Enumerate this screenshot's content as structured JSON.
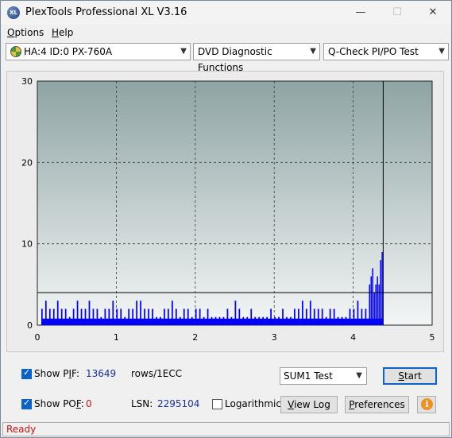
{
  "window": {
    "title": "PlexTools Professional XL V3.16",
    "icon_text": "XL"
  },
  "menu": [
    {
      "label": "Options",
      "accel": "O"
    },
    {
      "label": "Help",
      "accel": "H"
    }
  ],
  "toolbar": {
    "drive": "HA:4 ID:0  PX-760A",
    "function": "DVD Diagnostic Functions",
    "test": "Q-Check PI/PO Test"
  },
  "chart_data": {
    "type": "bar",
    "xlim": [
      0,
      5
    ],
    "ylim": [
      0,
      30
    ],
    "x_ticks": [
      "0",
      "1",
      "2",
      "3",
      "4",
      "5"
    ],
    "y_ticks": [
      "0",
      "10",
      "20",
      "30"
    ],
    "grid": true,
    "threshold": 4,
    "end_marker_x": 4.38,
    "series": [
      {
        "color": "#0000ff",
        "x": [
          0.05,
          0.1,
          0.15,
          0.2,
          0.25,
          0.3,
          0.35,
          0.4,
          0.45,
          0.5,
          0.55,
          0.6,
          0.65,
          0.7,
          0.75,
          0.8,
          0.85,
          0.9,
          0.95,
          1.0,
          1.05,
          1.1,
          1.15,
          1.2,
          1.25,
          1.3,
          1.35,
          1.4,
          1.45,
          1.5,
          1.55,
          1.6,
          1.65,
          1.7,
          1.75,
          1.8,
          1.85,
          1.9,
          1.95,
          2.0,
          2.05,
          2.1,
          2.15,
          2.2,
          2.25,
          2.3,
          2.35,
          2.4,
          2.45,
          2.5,
          2.55,
          2.6,
          2.65,
          2.7,
          2.75,
          2.8,
          2.85,
          2.9,
          2.95,
          3.0,
          3.05,
          3.1,
          3.15,
          3.2,
          3.25,
          3.3,
          3.35,
          3.4,
          3.45,
          3.5,
          3.55,
          3.6,
          3.65,
          3.7,
          3.75,
          3.8,
          3.85,
          3.9,
          3.95,
          4.0,
          4.05,
          4.1,
          4.15,
          4.2,
          4.22,
          4.24,
          4.26,
          4.28,
          4.3,
          4.32,
          4.34,
          4.36
        ],
        "y": [
          2,
          3,
          2,
          2,
          3,
          2,
          2,
          1,
          2,
          3,
          2,
          2,
          3,
          2,
          2,
          1,
          2,
          2,
          3,
          2,
          2,
          1,
          2,
          2,
          3,
          3,
          2,
          2,
          2,
          1,
          1,
          2,
          2,
          3,
          2,
          1,
          2,
          2,
          1,
          2,
          2,
          1,
          2,
          1,
          1,
          1,
          1,
          2,
          1,
          3,
          2,
          1,
          1,
          2,
          1,
          1,
          1,
          1,
          2,
          1,
          1,
          2,
          1,
          1,
          2,
          2,
          3,
          2,
          3,
          2,
          2,
          2,
          1,
          2,
          2,
          1,
          1,
          1,
          2,
          2,
          3,
          2,
          2,
          5,
          6,
          7,
          4,
          5,
          6,
          5,
          8,
          9
        ]
      }
    ]
  },
  "controls": {
    "show_pif": {
      "label": "Show PIF:",
      "accel": "I",
      "checked": true,
      "value": "13649",
      "unit": "rows/1ECC"
    },
    "show_pof": {
      "label": "Show POF:",
      "accel": "F",
      "checked": true,
      "value": "0"
    },
    "lsn": {
      "label": "LSN:",
      "value": "2295104"
    },
    "logarithmic": {
      "label": "Logarithmic",
      "checked": false
    },
    "test_select": "SUM1 Test",
    "start": "Start",
    "view_log": "View Log",
    "preferences": "Preferences"
  },
  "status": {
    "text": "Ready"
  }
}
